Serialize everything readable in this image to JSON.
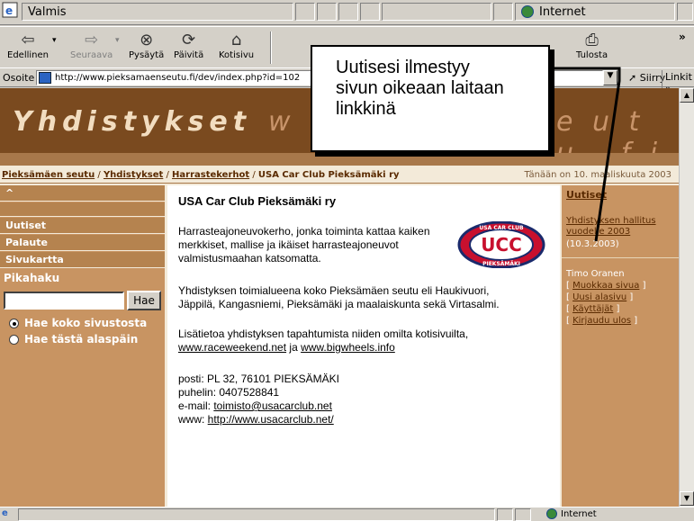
{
  "topbar": {
    "status_text": "Valmis",
    "zone_text": "Internet"
  },
  "toolbar": {
    "back": "Edellinen",
    "forward": "Seuraava",
    "stop": "Pysäytä",
    "refresh": "Päivitä",
    "home": "Kotisivu",
    "print": "Tulosta",
    "more": "»"
  },
  "address": {
    "label": "Osoite",
    "url": "http://www.pieksamaenseutu.fi/dev/index.php?id=102",
    "go": "Siirry",
    "links": "Linkit »"
  },
  "banner": {
    "title": "Yhdistykset",
    "url_part1": "w w",
    "url_part2": "e u t u . f i"
  },
  "breadcrumb": {
    "items": [
      "Pieksämäen seutu",
      "Yhdistykset",
      "Harrastekerhot"
    ],
    "current": "USA Car Club Pieksämäki ry",
    "date": "Tänään on 10. maaliskuuta 2003"
  },
  "left_nav": {
    "items": [
      "^",
      "",
      "Uutiset",
      "Palaute",
      "Sivukartta"
    ],
    "search_title": "Pikahaku",
    "search_button": "Hae",
    "radio_site": "Hae koko sivustosta",
    "radio_sub": "Hae tästä alaspäin"
  },
  "main": {
    "title": "USA Car Club Pieksämäki ry",
    "p1_l1": "Harrasteajoneuvokerho, jonka toiminta kattaa kaiken",
    "p1_l2": "merkkiset, mallise ja ikäiset harrasteajoneuvot",
    "p1_l3": "valmistusmaahan katsomatta.",
    "p2_l1": "Yhdistyksen toimialueena koko Pieksämäen seutu eli Haukivuori,",
    "p2_l2": "Jäppilä, Kangasniemi, Pieksämäki ja maalaiskunta sekä Virtasalmi.",
    "p3_l1": "Lisätietoa yhdistyksen tapahtumista niiden omilta kotisivuilta,",
    "p3_link1": "www.raceweekend.net",
    "p3_and": " ja ",
    "p3_link2": "www.bigwheels.info",
    "posti": "posti: PL 32, 76101 PIEKSÄMÄKI",
    "puhelin": "puhelin: 0407528841",
    "email_label": "e-mail: ",
    "email": "toimisto@usacarclub.net",
    "www_label": "www: ",
    "www": "http://www.usacarclub.net/",
    "logo_top": "USA CAR CLUB",
    "logo_mid": "UCC",
    "logo_bot": "PIEKSÄMÄKI"
  },
  "right_col": {
    "heading": "Uutiset",
    "news_l1": "Yhdistyksen hallitus",
    "news_l2": "vuodelle 2003",
    "news_date": "(10.3.2003)",
    "user": "Timo Oranen",
    "actions": [
      "Muokkaa sivua",
      "Uusi alasivu",
      "Käyttäjät",
      "Kirjaudu ulos"
    ]
  },
  "statusbar": {
    "zone": "Internet"
  },
  "callout": {
    "l1": "Uutisesi ilmestyy",
    "l2": "sivun oikeaan laitaan",
    "l3": "linkkinä"
  },
  "colors": {
    "banner": "#7a4a1f",
    "nav": "#c89462",
    "page_bg": "#f3ead9"
  }
}
